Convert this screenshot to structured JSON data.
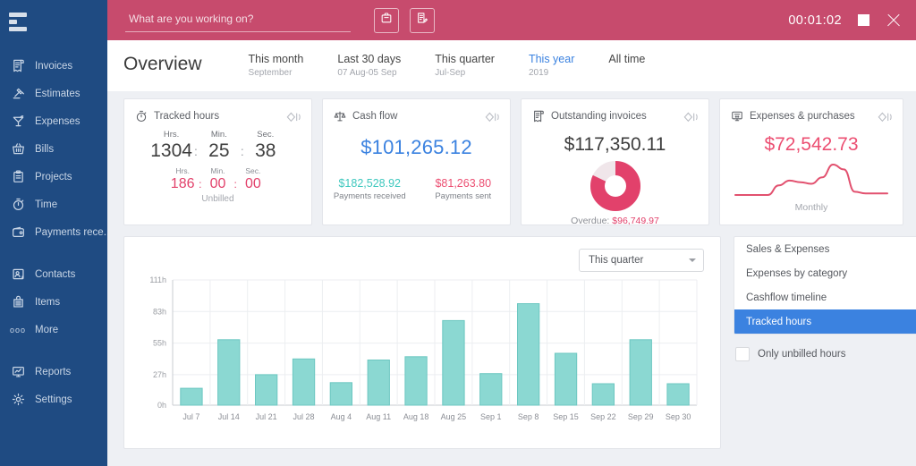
{
  "sidebar": {
    "logo": "menu-logo",
    "items": [
      {
        "label": "Invoices",
        "icon": "invoice-icon"
      },
      {
        "label": "Estimates",
        "icon": "gavel-icon"
      },
      {
        "label": "Expenses",
        "icon": "cocktail-icon"
      },
      {
        "label": "Bills",
        "icon": "basket-icon"
      },
      {
        "label": "Projects",
        "icon": "clipboard-icon"
      },
      {
        "label": "Time",
        "icon": "stopwatch-icon"
      },
      {
        "label": "Payments rece...",
        "icon": "wallet-icon"
      },
      {
        "label": "Contacts",
        "icon": "contact-card-icon"
      },
      {
        "label": "Items",
        "icon": "items-box-icon"
      },
      {
        "label": "More",
        "icon": "ellipsis-icon"
      },
      {
        "label": "Reports",
        "icon": "report-monitor-icon"
      },
      {
        "label": "Settings",
        "icon": "gear-icon"
      }
    ]
  },
  "topbar": {
    "timer_placeholder": "What are you working on?",
    "timer_value": "",
    "project_button": "briefcase-icon",
    "task_button": "task-note-icon",
    "clock": "00:01:02",
    "stop_button": "stop-square-icon",
    "close_button": "close-icon",
    "bg_color": "#c74b6d"
  },
  "header": {
    "title": "Overview",
    "tabs": [
      {
        "label": "This month",
        "sub": "September",
        "active": false
      },
      {
        "label": "Last 30 days",
        "sub": "07 Aug-05 Sep",
        "active": false
      },
      {
        "label": "This quarter",
        "sub": "Jul-Sep",
        "active": false
      },
      {
        "label": "This year",
        "sub": "2019",
        "active": true
      },
      {
        "label": "All time",
        "sub": "",
        "active": false
      }
    ],
    "active_color": "#3b82e0"
  },
  "cards": {
    "tracked_hours": {
      "title": "Tracked hours",
      "icon": "stopwatch-icon",
      "expand_icon": "expand-diamond-icon",
      "primary": {
        "hrs_label": "Hrs.",
        "hrs": "1304",
        "min_label": "Min.",
        "min": "25",
        "sec_label": "Sec.",
        "sec": "38",
        "separator": ":"
      },
      "secondary": {
        "hrs_label": "Hrs.",
        "hrs": "186",
        "min_label": "Min.",
        "min": "00",
        "sec_label": "Sec.",
        "sec": "00",
        "separator": ":",
        "color": "#e2416b"
      },
      "footer": "Unbilled"
    },
    "cash_flow": {
      "title": "Cash flow",
      "icon": "scales-icon",
      "expand_icon": "expand-diamond-icon",
      "amount": "$101,265.12",
      "amount_color": "#3b82e0",
      "received_amount": "$182,528.92",
      "received_label": "Payments received",
      "received_color": "#3fc8be",
      "sent_amount": "$81,263.80",
      "sent_label": "Payments sent",
      "sent_color": "#ec4f72"
    },
    "outstanding_invoices": {
      "title": "Outstanding invoices",
      "icon": "invoice-icon",
      "expand_icon": "expand-diamond-icon",
      "amount": "$117,350.11",
      "overdue_label": "Overdue:",
      "overdue_amount": "$96,749.97",
      "overdue_color": "#e2416b",
      "donut_percent": 82
    },
    "expenses_purchases": {
      "title": "Expenses & purchases",
      "icon": "expenses-monitor-icon",
      "expand_icon": "expand-diamond-icon",
      "amount": "$72,542.73",
      "amount_color": "#ec4f72",
      "footer": "Monthly",
      "sparkline": [
        8,
        8,
        8,
        8,
        20,
        26,
        24,
        22,
        30,
        46,
        40,
        12,
        10,
        10,
        10
      ]
    }
  },
  "chart_panel": {
    "range_select_value": "This quarter",
    "select_caret": "chevron-down-icon"
  },
  "side_panel": {
    "reports": [
      {
        "label": "Sales & Expenses",
        "selected": false
      },
      {
        "label": "Expenses by category",
        "selected": false
      },
      {
        "label": "Cashflow timeline",
        "selected": false
      },
      {
        "label": "Tracked hours",
        "selected": true
      }
    ],
    "selected_color": "#3b82e0",
    "checkbox": {
      "label": "Only unbilled hours",
      "checked": false
    }
  },
  "chart_data": {
    "type": "bar",
    "title": "Tracked hours",
    "xlabel": "",
    "ylabel": "",
    "categories": [
      "Jul 7",
      "Jul 14",
      "Jul 21",
      "Jul 28",
      "Aug 4",
      "Aug 11",
      "Aug 18",
      "Aug 25",
      "Sep 1",
      "Sep 8",
      "Sep 15",
      "Sep 22",
      "Sep 29",
      "Sep 30"
    ],
    "values": [
      15,
      58,
      27,
      41,
      20,
      40,
      43,
      75,
      28,
      90,
      46,
      19,
      58,
      19
    ],
    "ylim": [
      0,
      111
    ],
    "yticks": [
      0,
      27,
      55,
      83,
      111
    ],
    "ytick_labels": [
      "0h",
      "27h",
      "55h",
      "83h",
      "111h"
    ],
    "bar_color": "#8bd8d2",
    "bar_border": "#6cc7c1",
    "grid": true,
    "legend": false
  }
}
